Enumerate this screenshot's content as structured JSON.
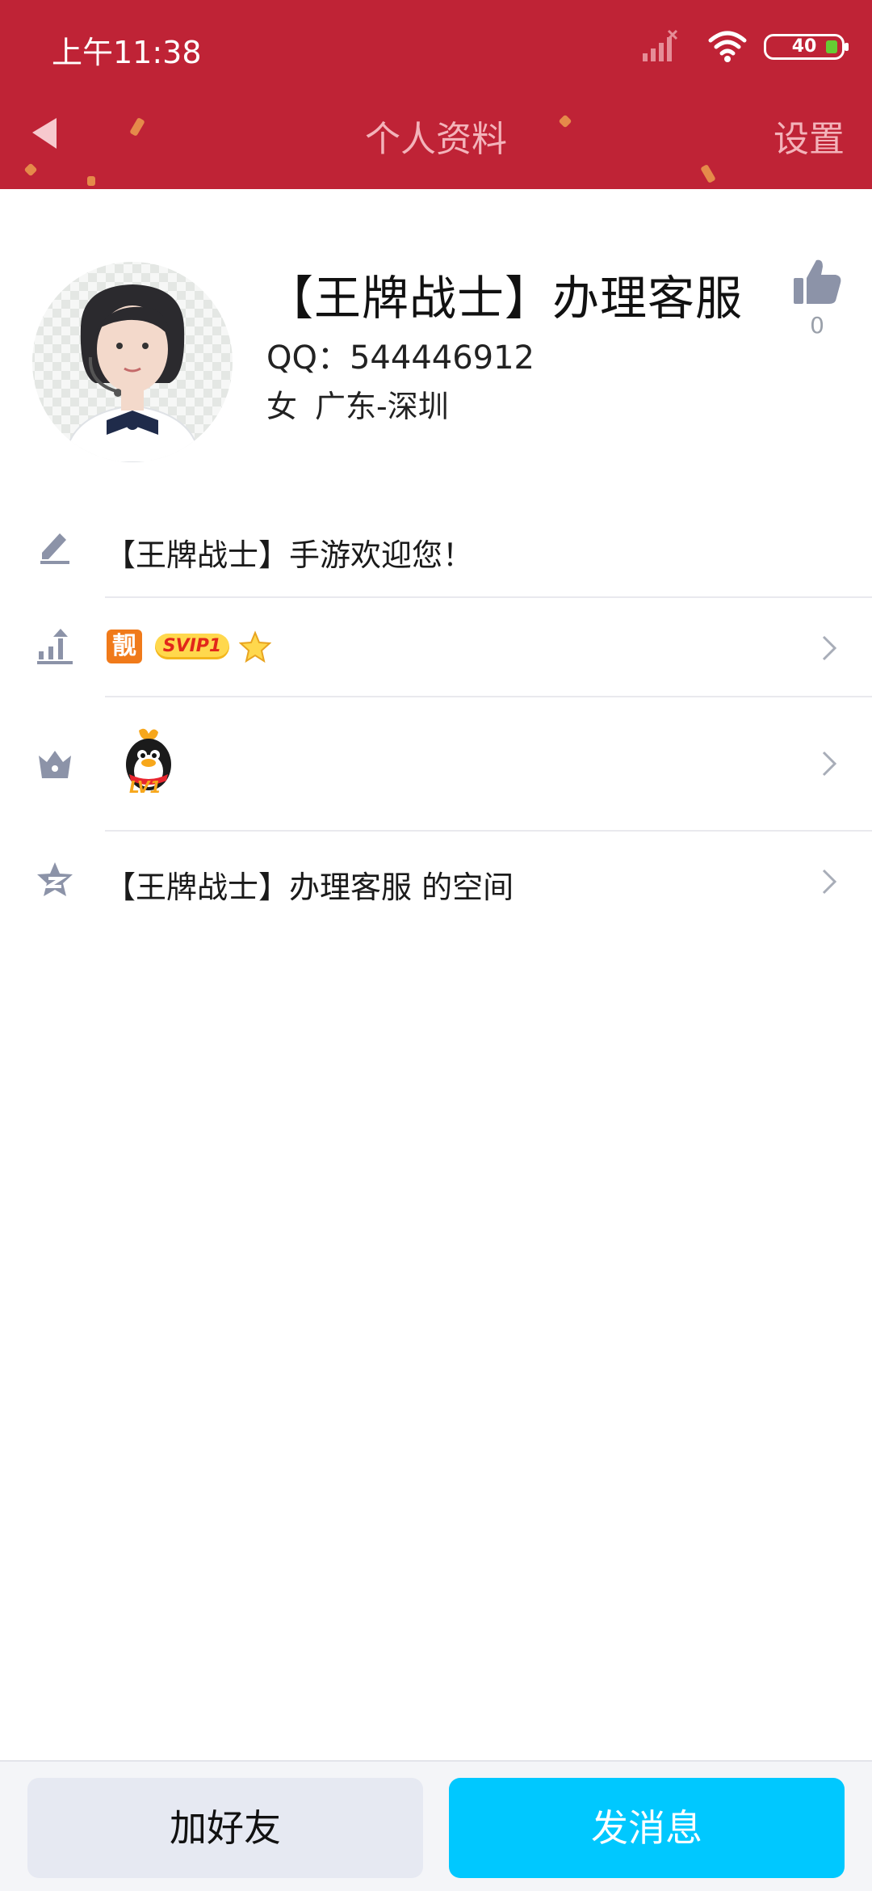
{
  "status_bar": {
    "time": "上午11:38",
    "battery": "40"
  },
  "header": {
    "title": "个人资料",
    "settings_label": "设置"
  },
  "profile": {
    "name": "【王牌战士】办理客服",
    "qq": "QQ：544446912",
    "gender": "女",
    "location": "广东-深圳",
    "likes": "0"
  },
  "rows": {
    "signature": "【王牌战士】手游欢迎您！",
    "vip": {
      "liang_badge": "靓",
      "svip_badge": "SVIP1"
    },
    "level_badge": "LV1",
    "space": "【王牌战士】办理客服  的空间"
  },
  "bottom": {
    "add_friend": "加好友",
    "send_message": "发消息"
  },
  "colors": {
    "header_bg": "#bf2336",
    "primary_button": "#00c8ff",
    "secondary_button": "#e6e9f2"
  }
}
